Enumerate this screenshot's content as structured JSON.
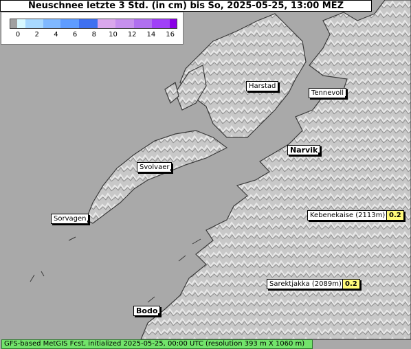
{
  "title": "Neuschnee letzte 3 Std. (in cm) bis So, 2025-05-25, 13:00 MEZ",
  "legend": {
    "colors": [
      "#a0a0a0",
      "#d8f8ff",
      "#a8d8ff",
      "#80b8ff",
      "#5f9cff",
      "#3f70f0",
      "#d9a7ec",
      "#c690ee",
      "#b070f0",
      "#a040f8",
      "#8a00e6"
    ],
    "ticks": [
      "0",
      "2",
      "4",
      "6",
      "8",
      "10",
      "12",
      "14",
      "16"
    ]
  },
  "places": [
    {
      "name": "Harstad",
      "big": false
    },
    {
      "name": "Tennevoll",
      "big": false
    },
    {
      "name": "Narvik",
      "big": true
    },
    {
      "name": "Svolvaer",
      "big": false
    },
    {
      "name": "Sorvagen",
      "big": false
    },
    {
      "name": "Kebenekaise (2113m)",
      "big": false,
      "value": "0.2"
    },
    {
      "name": "Sarektjakka (2089m)",
      "big": false,
      "value": "0.2"
    },
    {
      "name": "Bodo",
      "big": true
    }
  ],
  "footer": "GFS-based MetGIS Fcst, initialized 2025-05-25, 00:00 UTC  (resolution 393 m X 1060 m)",
  "colors": {
    "sea": "#a9a9a9",
    "land": "#c9c9c9",
    "coast": "#3a3a3a",
    "footer_bg": "#72e36b",
    "value_bg": "#fffa7a"
  }
}
